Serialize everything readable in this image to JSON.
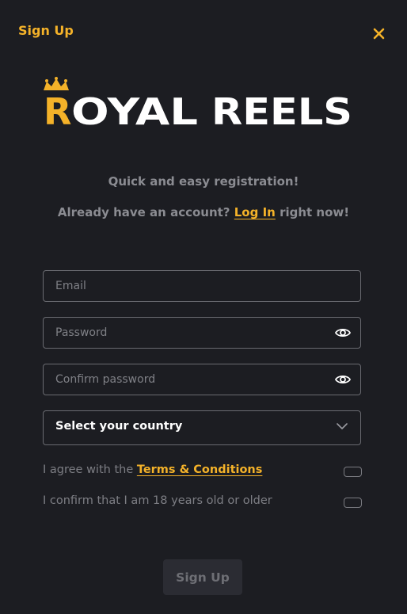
{
  "header": {
    "title": "Sign Up",
    "close_icon": "close-icon"
  },
  "logo": {
    "first_letter": "R",
    "rest_first": "OYAL",
    "second_word": "REELS",
    "crown_icon": "crown-icon"
  },
  "intro": {
    "tagline": "Quick and easy registration!",
    "login_prefix": "Already have an account?",
    "login_link": "Log In",
    "login_suffix": "right now!"
  },
  "form": {
    "email_placeholder": "Email",
    "password_placeholder": "Password",
    "confirm_placeholder": "Confirm password",
    "country_select": "Select your country",
    "terms_prefix": "I agree with the",
    "terms_link": "Terms & Conditions",
    "age_label": "I confirm that I am 18 years old or older",
    "submit_label": "Sign Up"
  },
  "colors": {
    "accent": "#f4b229",
    "background": "#1c1d22",
    "border": "#6a6b71",
    "muted_text": "#8b8c92"
  }
}
